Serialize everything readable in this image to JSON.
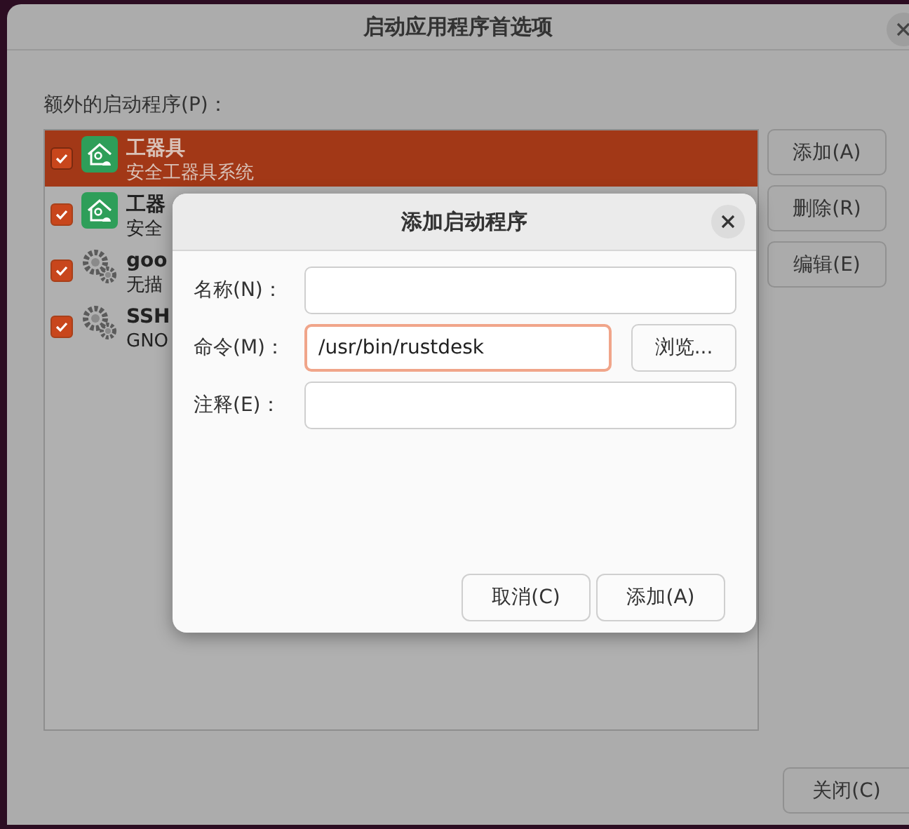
{
  "window": {
    "title": "启动应用程序首选项"
  },
  "list_label": "额外的启动程序(P)：",
  "programs": [
    {
      "name": "工器具",
      "description": "安全工器具系统",
      "checked": true,
      "selected": true,
      "kind": "app"
    },
    {
      "name": "工器",
      "description": "安全",
      "checked": true,
      "selected": false,
      "kind": "app"
    },
    {
      "name": "goo",
      "description": "无描",
      "checked": true,
      "selected": false,
      "kind": "system"
    },
    {
      "name": "SSH",
      "description": "GNO",
      "checked": true,
      "selected": false,
      "kind": "system"
    }
  ],
  "side_buttons": [
    "添加(A)",
    "删除(R)",
    "编辑(E)"
  ],
  "close_button": "关闭(C)",
  "dialog": {
    "title": "添加启动程序",
    "fields": [
      {
        "label": "名称(N)：",
        "focused": false
      },
      {
        "label": "命令(M)：",
        "value": "/usr/bin/rustdesk",
        "focused": true,
        "button": "浏览..."
      },
      {
        "label": "注释(E)：",
        "focused": false
      }
    ],
    "buttons": [
      "取消(C)",
      "添加(A)"
    ]
  }
}
